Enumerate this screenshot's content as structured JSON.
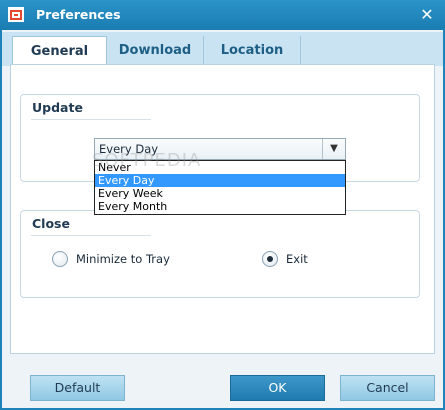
{
  "window": {
    "title": "Preferences",
    "close_glyph": "✕"
  },
  "tabs": [
    {
      "label": "General",
      "active": true
    },
    {
      "label": "Download",
      "active": false
    },
    {
      "label": "Location",
      "active": false
    }
  ],
  "update": {
    "title": "Update",
    "selected": "Every Day",
    "options": [
      {
        "label": "Never",
        "highlighted": false
      },
      {
        "label": "Every Day",
        "highlighted": true
      },
      {
        "label": "Every Week",
        "highlighted": false
      },
      {
        "label": "Every Month",
        "highlighted": false
      }
    ]
  },
  "close": {
    "title": "Close",
    "minimize_label": "Minimize to Tray",
    "exit_label": "Exit",
    "selected": "Exit"
  },
  "buttons": {
    "default": "Default",
    "ok": "OK",
    "cancel": "Cancel"
  },
  "watermark": "SOFTPEDIA"
}
